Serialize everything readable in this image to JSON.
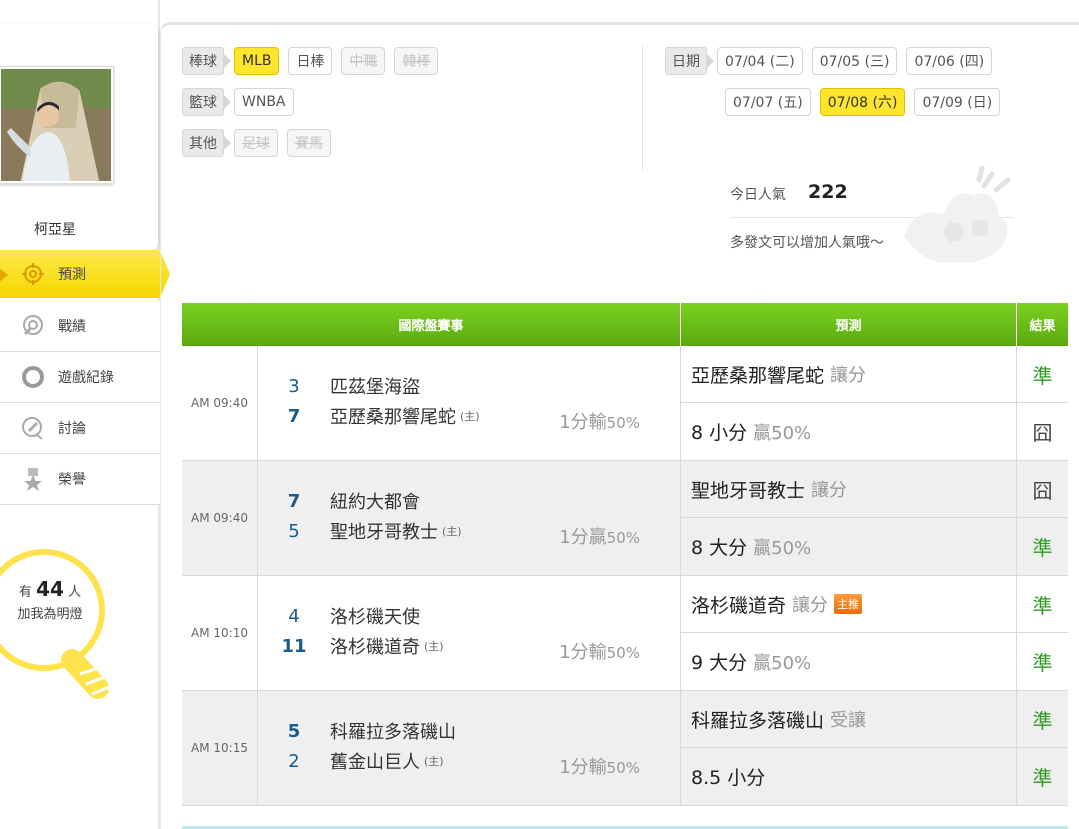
{
  "user": {
    "name": "柯亞星"
  },
  "nav": [
    {
      "label": "預測",
      "icon": "target-icon",
      "active": true
    },
    {
      "label": "戰績",
      "icon": "record-icon",
      "active": false
    },
    {
      "label": "遊戲紀錄",
      "icon": "ring-icon",
      "active": false
    },
    {
      "label": "討論",
      "icon": "chat-icon",
      "active": false
    },
    {
      "label": "榮譽",
      "icon": "medal-icon",
      "active": false
    }
  ],
  "fans": {
    "prefix": "有",
    "count": "44",
    "suffix": "人",
    "caption": "加我為明燈"
  },
  "categories": [
    {
      "label": "棒球",
      "chips": [
        {
          "label": "MLB",
          "state": "selected"
        },
        {
          "label": "日棒",
          "state": "normal"
        },
        {
          "label": "中職",
          "state": "disabled"
        },
        {
          "label": "韓棒",
          "state": "disabled"
        }
      ]
    },
    {
      "label": "籃球",
      "chips": [
        {
          "label": "WNBA",
          "state": "normal"
        }
      ]
    },
    {
      "label": "其他",
      "chips": [
        {
          "label": "足球",
          "state": "disabled"
        },
        {
          "label": "賽馬",
          "state": "disabled"
        }
      ]
    }
  ],
  "dates": {
    "label": "日期",
    "row1": [
      {
        "label": "07/04 (二)",
        "state": "normal"
      },
      {
        "label": "07/05 (三)",
        "state": "normal"
      },
      {
        "label": "07/06 (四)",
        "state": "normal"
      }
    ],
    "row2": [
      {
        "label": "07/07 (五)",
        "state": "normal"
      },
      {
        "label": "07/08 (六)",
        "state": "selected"
      },
      {
        "label": "07/09 (日)",
        "state": "normal"
      }
    ]
  },
  "popularity": {
    "label": "今日人氣",
    "value": "222",
    "hint": "多發文可以增加人氣哦～"
  },
  "table": {
    "headers": {
      "match": "國際盤賽事",
      "prediction": "預測",
      "result": "結果"
    },
    "home_mark": "(主)",
    "games": [
      {
        "time": "AM 09:40",
        "away": {
          "score": "3",
          "name": "匹茲堡海盜"
        },
        "home": {
          "score": "7",
          "name": "亞歷桑那響尾蛇"
        },
        "winner": "home",
        "spread": {
          "text": "1分輸",
          "pct": "50%"
        },
        "predictions": [
          {
            "main": "亞歷桑那響尾蛇",
            "sub": "讓分",
            "badge": "",
            "result": "準",
            "hit": true
          },
          {
            "main": "8 小分",
            "sub": "贏50%",
            "badge": "",
            "result": "囧",
            "hit": false
          }
        ]
      },
      {
        "time": "AM 09:40",
        "away": {
          "score": "7",
          "name": "紐約大都會"
        },
        "home": {
          "score": "5",
          "name": "聖地牙哥教士"
        },
        "winner": "away",
        "spread": {
          "text": "1分贏",
          "pct": "50%"
        },
        "predictions": [
          {
            "main": "聖地牙哥教士",
            "sub": "讓分",
            "badge": "",
            "result": "囧",
            "hit": false
          },
          {
            "main": "8 大分",
            "sub": "贏50%",
            "badge": "",
            "result": "準",
            "hit": true
          }
        ]
      },
      {
        "time": "AM 10:10",
        "away": {
          "score": "4",
          "name": "洛杉磯天使"
        },
        "home": {
          "score": "11",
          "name": "洛杉磯道奇"
        },
        "winner": "home",
        "spread": {
          "text": "1分輸",
          "pct": "50%"
        },
        "predictions": [
          {
            "main": "洛杉磯道奇",
            "sub": "讓分",
            "badge": "主推",
            "result": "準",
            "hit": true
          },
          {
            "main": "9 大分",
            "sub": "贏50%",
            "badge": "",
            "result": "準",
            "hit": true
          }
        ]
      },
      {
        "time": "AM 10:15",
        "away": {
          "score": "5",
          "name": "科羅拉多落磯山"
        },
        "home": {
          "score": "2",
          "name": "舊金山巨人"
        },
        "winner": "away",
        "spread": {
          "text": "1分輸",
          "pct": "50%"
        },
        "predictions": [
          {
            "main": "科羅拉多落磯山",
            "sub": "受讓",
            "badge": "",
            "result": "準",
            "hit": true
          },
          {
            "main": "8.5 小分",
            "sub": "",
            "badge": "",
            "result": "準",
            "hit": true
          }
        ]
      }
    ]
  }
}
